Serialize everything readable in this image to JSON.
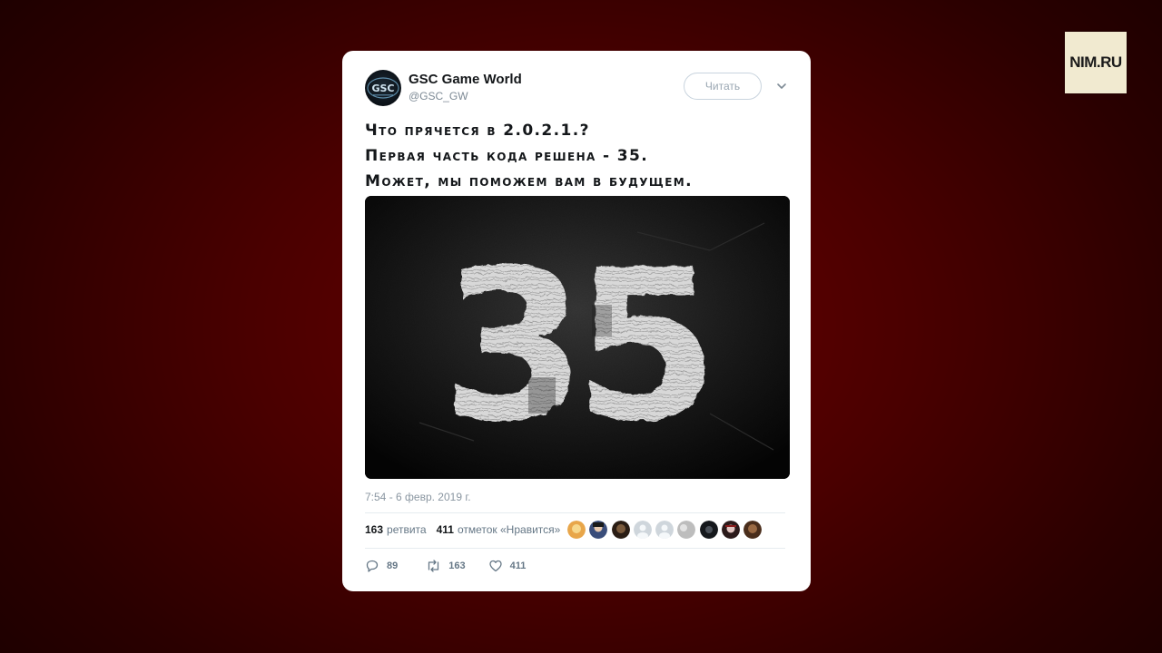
{
  "watermark": {
    "text": "NIM.RU"
  },
  "tweet": {
    "author_name": "GSC Game World",
    "author_handle": "@GSC_GW",
    "avatar_text": "GSC",
    "follow_label": "Читать",
    "text_lines": [
      "Что прячется в 2.0.2.1.?",
      "Первая часть кода решена - 35.",
      "Может, мы поможем вам в будущем."
    ],
    "media_text": "35",
    "timestamp": "7:54 - 6 февр. 2019 г.",
    "retweets_count": "163",
    "retweets_label": "ретвита",
    "likes_count": "411",
    "likes_label": "отметок «Нравится»",
    "actions": {
      "reply_count": "89",
      "retweet_count": "163",
      "like_count": "411"
    }
  },
  "colors": {
    "background_red": "#6a0000",
    "card": "#ffffff",
    "text": "#14171a",
    "muted": "#657786"
  }
}
